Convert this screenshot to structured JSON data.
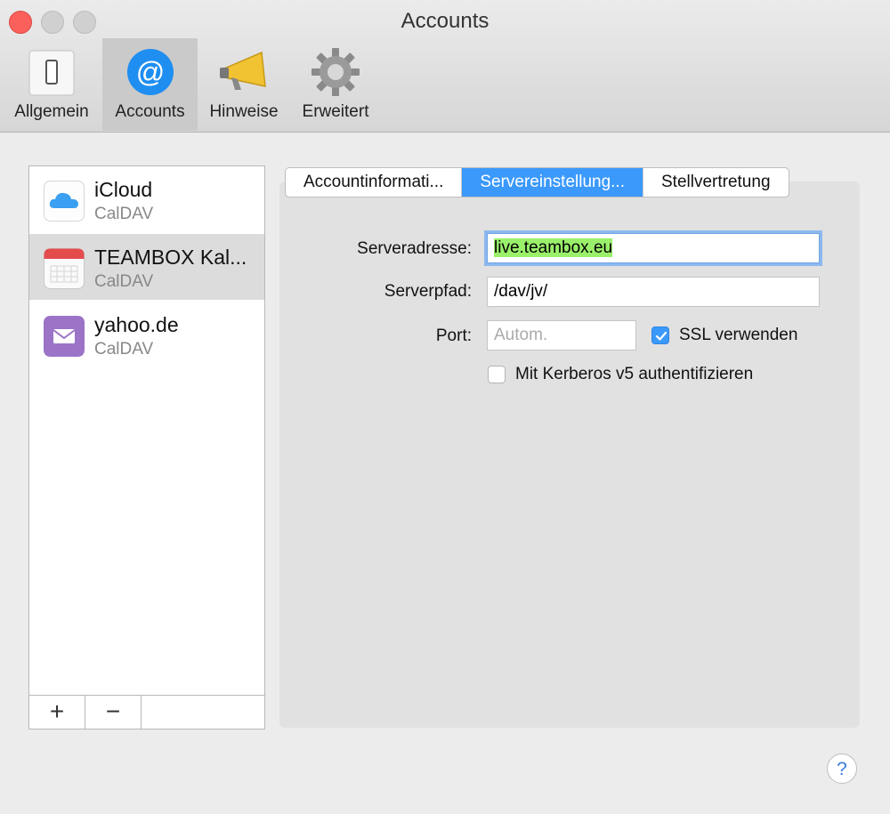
{
  "window": {
    "title": "Accounts"
  },
  "toolbar": {
    "items": [
      {
        "label": "Allgemein",
        "icon": "switch-icon"
      },
      {
        "label": "Accounts",
        "icon": "at-sign-icon"
      },
      {
        "label": "Hinweise",
        "icon": "megaphone-icon"
      },
      {
        "label": "Erweitert",
        "icon": "gear-icon"
      }
    ],
    "active": "Accounts"
  },
  "accounts": [
    {
      "name": "iCloud",
      "type": "CalDAV",
      "icon": "icloud-icon"
    },
    {
      "name": "TEAMBOX Kal...",
      "type": "CalDAV",
      "icon": "calendar-icon",
      "selected": true
    },
    {
      "name": "yahoo.de",
      "type": "CalDAV",
      "icon": "mail-icon"
    }
  ],
  "list_buttons": {
    "add": "+",
    "remove": "−"
  },
  "tabs": [
    {
      "label": "Accountinformati..."
    },
    {
      "label": "Servereinstellung...",
      "active": true
    },
    {
      "label": "Stellvertretung"
    }
  ],
  "server": {
    "address_label": "Serveradresse:",
    "address_value": "live.teambox.eu",
    "path_label": "Serverpfad:",
    "path_value": "/dav/jv/",
    "port_label": "Port:",
    "port_placeholder": "Autom.",
    "ssl_label": "SSL verwenden",
    "ssl_checked": true,
    "kerberos_label": "Mit Kerberos v5 authentifizieren",
    "kerberos_checked": false
  },
  "help": {
    "label": "?"
  },
  "colors": {
    "accent": "#3b99fc",
    "close": "#fc605b",
    "highlight": "#9af06a"
  }
}
